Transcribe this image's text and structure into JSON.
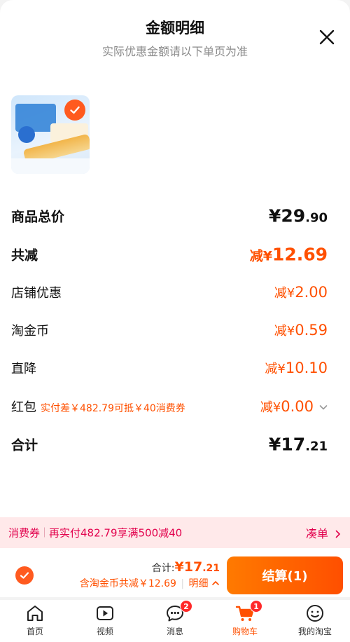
{
  "header": {
    "title": "金额明细",
    "subtitle": "实际优惠金额请以下单页为准"
  },
  "product": {
    "thumb_icon": "cake-product-image",
    "selected": true
  },
  "rows": {
    "total_price": {
      "label": "商品总价",
      "symbol": "¥",
      "int": "29",
      "dec": ".90"
    },
    "total_reduce": {
      "label": "共减",
      "prefix": "减¥",
      "amount": "12.69"
    },
    "shop_discount": {
      "label": "店铺优惠",
      "prefix": "减¥",
      "amount": "2.00"
    },
    "taojinbi": {
      "label": "淘金币",
      "prefix": "减¥",
      "amount": "0.59"
    },
    "direct_drop": {
      "label": "直降",
      "prefix": "减¥",
      "amount": "10.10"
    },
    "hongbao": {
      "label": "红包",
      "note": "实付差￥482.79可抵￥40消费券",
      "prefix": "减¥",
      "amount": "0.00"
    },
    "subtotal": {
      "label": "合计",
      "symbol": "¥",
      "int": "17",
      "dec": ".21"
    }
  },
  "coupon_bar": {
    "tag": "消费券",
    "text": "再实付482.79享满500减40",
    "action": "凑单"
  },
  "checkout": {
    "sum_label": "合计:",
    "sum_symbol": "¥",
    "sum_int": "17",
    "sum_dec": ".21",
    "sum_note": "含淘金币共减￥12.69",
    "detail_label": "明细",
    "button_label": "结算(1)"
  },
  "tabbar": [
    {
      "label": "首页",
      "icon": "home-icon",
      "active": false
    },
    {
      "label": "视频",
      "icon": "video-icon",
      "active": false
    },
    {
      "label": "消息",
      "icon": "message-icon",
      "badge": "2",
      "active": false
    },
    {
      "label": "购物车",
      "icon": "cart-icon",
      "badge": "1",
      "active": true
    },
    {
      "label": "我的淘宝",
      "icon": "my-taobao-icon",
      "active": false
    }
  ],
  "colors": {
    "accent": "#ff5000",
    "coupon_text": "#e2004c",
    "coupon_bg": "#ffe9ea"
  }
}
